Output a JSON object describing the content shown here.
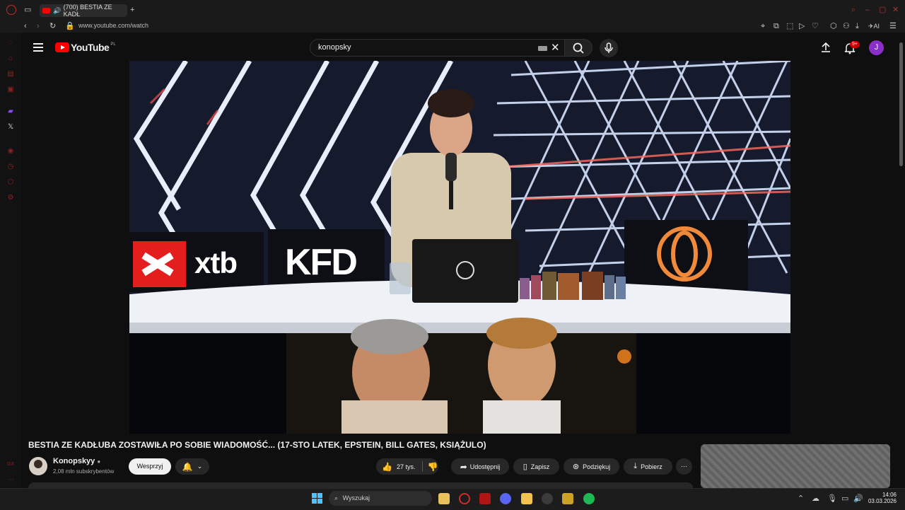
{
  "browser": {
    "tab_title": "(700) BESTIA ZE KADŁ",
    "url": "www.youtube.com/watch",
    "toolbar_ai": "AI"
  },
  "youtube": {
    "logo_text": "YouTube",
    "region": "PL",
    "search_value": "konopsky",
    "notifications_badge": "9+",
    "avatar_letter": "J"
  },
  "video": {
    "overlay_brands": [
      "xtb",
      "KFD"
    ],
    "title": "BESTIA ZE KADŁUBA ZOSTAWIŁA PO SOBIE WIADOMOŚĆ... (17-STO LATEK, EPSTEIN, BILL GATES, KSIĄŻULO)"
  },
  "channel": {
    "name": "Konopskyy",
    "subscribers": "2,08 mln subskrybentów",
    "support_label": "Wesprzyj"
  },
  "actions": {
    "likes": "27 tys.",
    "share": "Udostępnij",
    "save": "Zapisz",
    "thanks": "Podziękuj",
    "download": "Pobierz"
  },
  "taskbar": {
    "search_placeholder": "Wyszukaj",
    "time": "14:06",
    "date": "03.03.2026"
  },
  "colors": {
    "accent": "#ff0000",
    "avatar": "#8b2fc9"
  }
}
